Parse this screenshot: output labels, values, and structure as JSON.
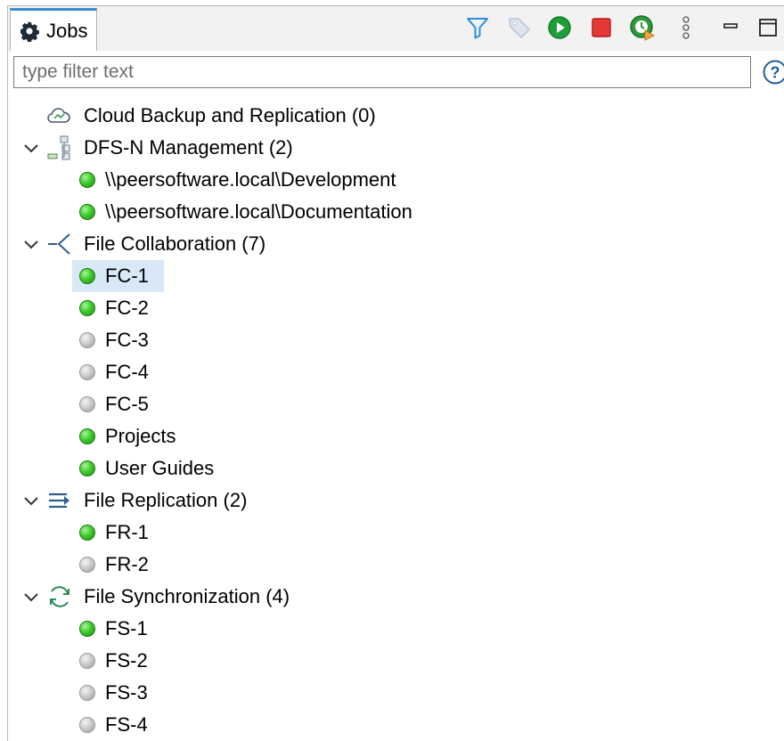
{
  "tab": {
    "label": "Jobs",
    "icon": "gear-icon"
  },
  "toolbar": {
    "items": [
      {
        "name": "filter-icon",
        "color": "#2a8fd8"
      },
      {
        "name": "tag-icon",
        "color": "#b9c6d8"
      },
      {
        "name": "start-icon",
        "color": "#1f9d38"
      },
      {
        "name": "stop-icon",
        "color": "#e53935"
      },
      {
        "name": "run-scheduled-icon",
        "color": "#2e9a3c"
      },
      {
        "name": "view-menu-icon"
      },
      {
        "name": "minimize-icon"
      },
      {
        "name": "maximize-icon"
      }
    ]
  },
  "filter": {
    "placeholder": "type filter text",
    "value": ""
  },
  "tree": {
    "groups": [
      {
        "label": "Cloud Backup and Replication (0)",
        "icon": "cloud-icon",
        "expanded": false,
        "items": []
      },
      {
        "label": "DFS-N Management (2)",
        "icon": "dfs-network-icon",
        "expanded": true,
        "items": [
          {
            "label": "\\\\peersoftware.local\\Development",
            "status": "green"
          },
          {
            "label": "\\\\peersoftware.local\\Documentation",
            "status": "green"
          }
        ]
      },
      {
        "label": "File Collaboration (7)",
        "icon": "collaboration-icon",
        "expanded": true,
        "items": [
          {
            "label": "FC-1",
            "status": "green",
            "selected": true
          },
          {
            "label": "FC-2",
            "status": "green"
          },
          {
            "label": "FC-3",
            "status": "gray"
          },
          {
            "label": "FC-4",
            "status": "gray"
          },
          {
            "label": "FC-5",
            "status": "gray"
          },
          {
            "label": "Projects",
            "status": "green"
          },
          {
            "label": "User Guides",
            "status": "green"
          }
        ]
      },
      {
        "label": "File Replication (2)",
        "icon": "replication-arrows-icon",
        "expanded": true,
        "items": [
          {
            "label": "FR-1",
            "status": "green"
          },
          {
            "label": "FR-2",
            "status": "gray"
          }
        ]
      },
      {
        "label": "File Synchronization (4)",
        "icon": "sync-icon",
        "expanded": true,
        "items": [
          {
            "label": "FS-1",
            "status": "green"
          },
          {
            "label": "FS-2",
            "status": "gray"
          },
          {
            "label": "FS-3",
            "status": "gray"
          },
          {
            "label": "FS-4",
            "status": "gray"
          }
        ]
      }
    ]
  }
}
